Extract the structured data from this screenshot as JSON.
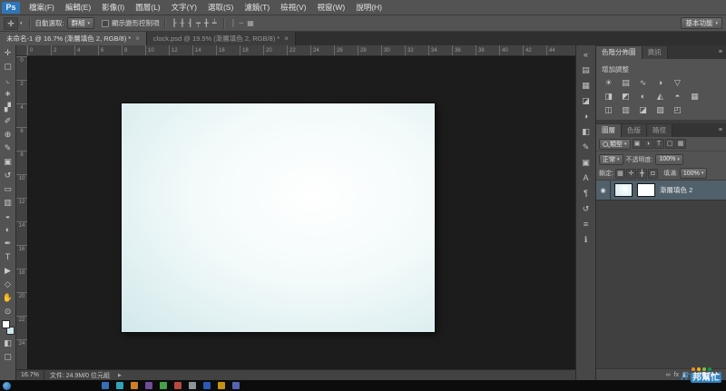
{
  "app": {
    "logo": "Ps"
  },
  "icons": {
    "caret": "▾",
    "panel_menu": "≡",
    "eye": "◉",
    "tab_close": "×",
    "status_arrow": "▶"
  },
  "menubar": {
    "items": [
      "檔案(F)",
      "編輯(E)",
      "影像(I)",
      "圖層(L)",
      "文字(Y)",
      "選取(S)",
      "濾鏡(T)",
      "檢視(V)",
      "視窗(W)",
      "說明(H)"
    ]
  },
  "options": {
    "tool_icon": "✛",
    "auto_select_label": "自動選取:",
    "auto_select_value": "群組",
    "transform_label": "顯示變形控制項",
    "align_icons": [
      {
        "name": "align-left-edges-icon",
        "glyph": "┠"
      },
      {
        "name": "align-horizontal-centers-icon",
        "glyph": "╂"
      },
      {
        "name": "align-right-edges-icon",
        "glyph": "┨"
      },
      {
        "name": "align-top-edges-icon",
        "glyph": "┯"
      },
      {
        "name": "align-vertical-centers-icon",
        "glyph": "╋"
      },
      {
        "name": "align-bottom-edges-icon",
        "glyph": "┷"
      }
    ],
    "distribute_icons": [
      {
        "name": "distribute-vertical-icon",
        "glyph": "┆"
      },
      {
        "name": "distribute-horizontal-icon",
        "glyph": "┄"
      },
      {
        "name": "auto-align-layers-icon",
        "glyph": "▦"
      }
    ],
    "workspace_value": "基本功能"
  },
  "doc_tabs": {
    "tab1": "未命名-1 @ 16.7% (漸層填色 2, RGB/8) *",
    "tab2": "clock.psd @ 19.5% (漸層填色 2, RGB/8) *"
  },
  "toolbar": {
    "tools": [
      {
        "name": "move-tool",
        "glyph": "✛"
      },
      {
        "name": "marquee-tool",
        "glyph": "▢"
      },
      {
        "name": "lasso-tool",
        "glyph": "◟"
      },
      {
        "name": "quick-selection-tool",
        "glyph": "∗"
      },
      {
        "name": "crop-tool",
        "glyph": "▞"
      },
      {
        "name": "eyedropper-tool",
        "glyph": "✐"
      },
      {
        "name": "healing-brush-tool",
        "glyph": "⊕"
      },
      {
        "name": "brush-tool",
        "glyph": "✎"
      },
      {
        "name": "clone-stamp-tool",
        "glyph": "▣"
      },
      {
        "name": "history-brush-tool",
        "glyph": "↺"
      },
      {
        "name": "eraser-tool",
        "glyph": "▭"
      },
      {
        "name": "gradient-tool",
        "glyph": "▥"
      },
      {
        "name": "blur-tool",
        "glyph": "◒"
      },
      {
        "name": "dodge-tool",
        "glyph": "◐"
      },
      {
        "name": "pen-tool",
        "glyph": "✒"
      },
      {
        "name": "type-tool",
        "glyph": "T"
      },
      {
        "name": "path-selection-tool",
        "glyph": "▶"
      },
      {
        "name": "shape-tool",
        "glyph": "◇"
      },
      {
        "name": "hand-tool",
        "glyph": "✋"
      },
      {
        "name": "zoom-tool",
        "glyph": "⊙"
      }
    ],
    "quick_mask_glyph": "◧",
    "screen_mode_glyph": "▢"
  },
  "ruler": {
    "h": [
      "0",
      "2",
      "4",
      "6",
      "8",
      "10",
      "12",
      "14",
      "16",
      "18",
      "20",
      "22",
      "24",
      "26",
      "28",
      "30",
      "32",
      "34",
      "36",
      "38",
      "40",
      "42",
      "44"
    ],
    "v": [
      "0",
      "2",
      "4",
      "6",
      "8",
      "10",
      "12",
      "14",
      "16",
      "18",
      "20",
      "22",
      "24"
    ]
  },
  "statusbar": {
    "zoom": "16.7%",
    "doc_info": "文件: 24.9M/0 位元組"
  },
  "dock": {
    "icons": [
      {
        "name": "collapse-panels-icon",
        "glyph": "«"
      },
      {
        "name": "swatches-panel-icon",
        "glyph": "▤"
      },
      {
        "name": "color-panel-icon",
        "glyph": "▦"
      },
      {
        "name": "styles-panel-icon",
        "glyph": "◪"
      },
      {
        "name": "adjustments-panel-icon",
        "glyph": "◑"
      },
      {
        "name": "masks-panel-icon",
        "glyph": "◧"
      },
      {
        "name": "brush-panel-icon",
        "glyph": "✎"
      },
      {
        "name": "clone-source-panel-icon",
        "glyph": "▣"
      },
      {
        "name": "character-panel-icon",
        "glyph": "A"
      },
      {
        "name": "paragraph-panel-icon",
        "glyph": "¶"
      },
      {
        "name": "history-panel-icon",
        "glyph": "↺"
      },
      {
        "name": "properties-panel-icon",
        "glyph": "≡"
      },
      {
        "name": "info-panel-icon",
        "glyph": "ℹ"
      }
    ]
  },
  "panels": {
    "histogram": {
      "tab1": "色階分佈圖",
      "tab2": "資訊"
    },
    "adjustments": {
      "header": "增加調整",
      "row1": [
        {
          "name": "brightness-contrast-icon",
          "glyph": "☀"
        },
        {
          "name": "levels-icon",
          "glyph": "▤"
        },
        {
          "name": "curves-icon",
          "glyph": "∿"
        },
        {
          "name": "exposure-icon",
          "glyph": "◑"
        },
        {
          "name": "vibrance-icon",
          "glyph": "▽"
        }
      ],
      "row2": [
        {
          "name": "hue-saturation-icon",
          "glyph": "◨"
        },
        {
          "name": "color-balance-icon",
          "glyph": "◩"
        },
        {
          "name": "black-white-icon",
          "glyph": "◐"
        },
        {
          "name": "photo-filter-icon",
          "glyph": "◭"
        },
        {
          "name": "channel-mixer-icon",
          "glyph": "◓"
        },
        {
          "name": "color-lookup-icon",
          "glyph": "▦"
        }
      ],
      "row3": [
        {
          "name": "invert-icon",
          "glyph": "◫"
        },
        {
          "name": "posterize-icon",
          "glyph": "▥"
        },
        {
          "name": "threshold-icon",
          "glyph": "◪"
        },
        {
          "name": "gradient-map-icon",
          "glyph": "▧"
        },
        {
          "name": "selective-color-icon",
          "glyph": "◰"
        }
      ]
    },
    "layers": {
      "tab1": "圖層",
      "tab2": "色版",
      "tab3": "路徑",
      "filter_label": "類型",
      "filter_icons": [
        {
          "name": "filter-pixel-layers-icon",
          "glyph": "▣"
        },
        {
          "name": "filter-adjustment-layers-icon",
          "glyph": "◑"
        },
        {
          "name": "filter-type-layers-icon",
          "glyph": "T"
        },
        {
          "name": "filter-shape-layers-icon",
          "glyph": "▢"
        },
        {
          "name": "filter-smart-objects-icon",
          "glyph": "▦"
        }
      ],
      "blend_mode": "正常",
      "opacity_label": "不透明度:",
      "opacity_value": "100%",
      "lock_label": "鎖定:",
      "lock_icons": [
        {
          "name": "lock-transparency-icon",
          "glyph": "▩"
        },
        {
          "name": "lock-pixels-icon",
          "glyph": "✛"
        },
        {
          "name": "lock-position-icon",
          "glyph": "╋"
        },
        {
          "name": "lock-all-icon",
          "glyph": "◘"
        }
      ],
      "fill_label": "填滿:",
      "fill_value": "100%",
      "layer": {
        "name": "漸層填色 2"
      },
      "bottom_icons": [
        {
          "name": "link-layers-icon",
          "glyph": "∞"
        },
        {
          "name": "layer-effects-icon",
          "glyph": "fx"
        },
        {
          "name": "layer-mask-icon",
          "glyph": "◧"
        },
        {
          "name": "new-adjustment-layer-icon",
          "glyph": "◑"
        },
        {
          "name": "new-group-icon",
          "glyph": "❏"
        },
        {
          "name": "new-layer-icon",
          "glyph": "⊞"
        },
        {
          "name": "delete-layer-icon",
          "glyph": "▯"
        }
      ]
    }
  },
  "taskbar": {
    "icons": [
      {
        "color": "#3b78c4"
      },
      {
        "color": "#35b1c9"
      },
      {
        "color": "#e08b2d"
      },
      {
        "color": "#7a52a8"
      },
      {
        "color": "#4caf50"
      },
      {
        "color": "#c94f43"
      },
      {
        "color": "#9aa0a6"
      },
      {
        "color": "#2d62c9"
      },
      {
        "color": "#d4a017"
      },
      {
        "color": "#5c6bc0"
      }
    ]
  },
  "watermark": {
    "it": "iT",
    "rest": "邦幫忙",
    "dots": [
      {
        "color": "#f7941d"
      },
      {
        "color": "#fdb913"
      },
      {
        "color": "#8dc63f"
      },
      {
        "color": "#00a651"
      }
    ]
  }
}
